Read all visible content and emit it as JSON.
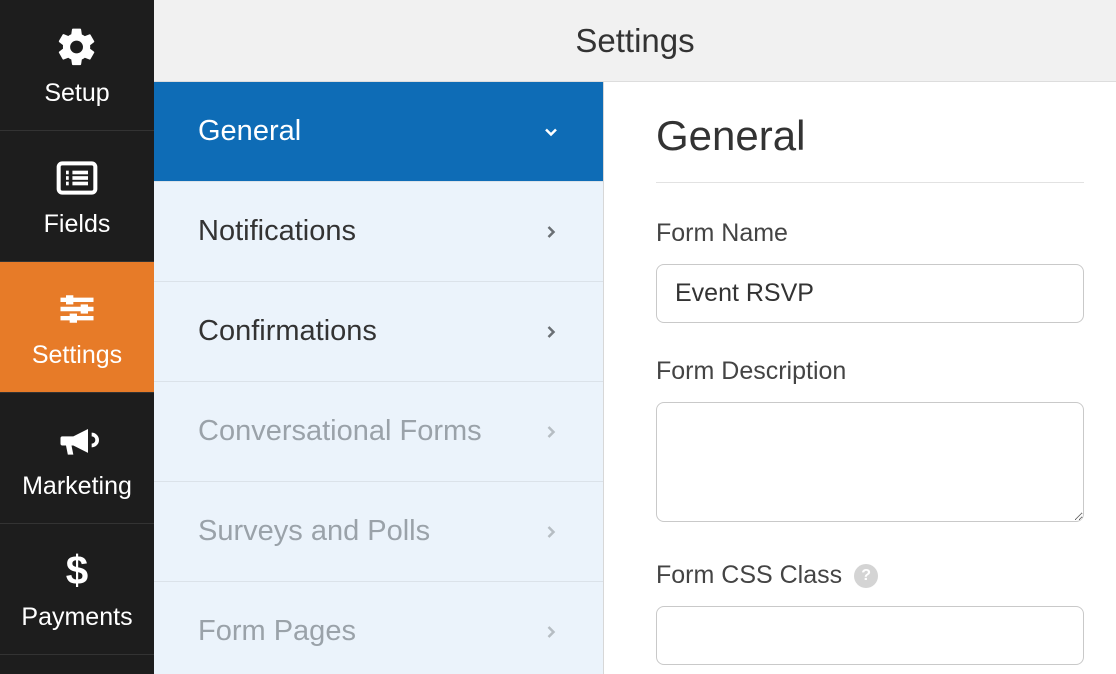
{
  "topbar": {
    "title": "Settings"
  },
  "leftnav": {
    "items": [
      {
        "label": "Setup",
        "icon": "gear-icon",
        "active": false
      },
      {
        "label": "Fields",
        "icon": "list-icon",
        "active": false
      },
      {
        "label": "Settings",
        "icon": "sliders-icon",
        "active": true
      },
      {
        "label": "Marketing",
        "icon": "bullhorn-icon",
        "active": false
      },
      {
        "label": "Payments",
        "icon": "dollar-icon",
        "active": false
      }
    ]
  },
  "settings_panel": {
    "items": [
      {
        "label": "General",
        "active": true,
        "muted": false,
        "expanded": true
      },
      {
        "label": "Notifications",
        "active": false,
        "muted": false
      },
      {
        "label": "Confirmations",
        "active": false,
        "muted": false
      },
      {
        "label": "Conversational Forms",
        "active": false,
        "muted": true
      },
      {
        "label": "Surveys and Polls",
        "active": false,
        "muted": true
      },
      {
        "label": "Form Pages",
        "active": false,
        "muted": true
      }
    ]
  },
  "content": {
    "heading": "General",
    "form_name": {
      "label": "Form Name",
      "value": "Event RSVP"
    },
    "form_description": {
      "label": "Form Description",
      "value": ""
    },
    "form_css_class": {
      "label": "Form CSS Class",
      "value": ""
    }
  }
}
